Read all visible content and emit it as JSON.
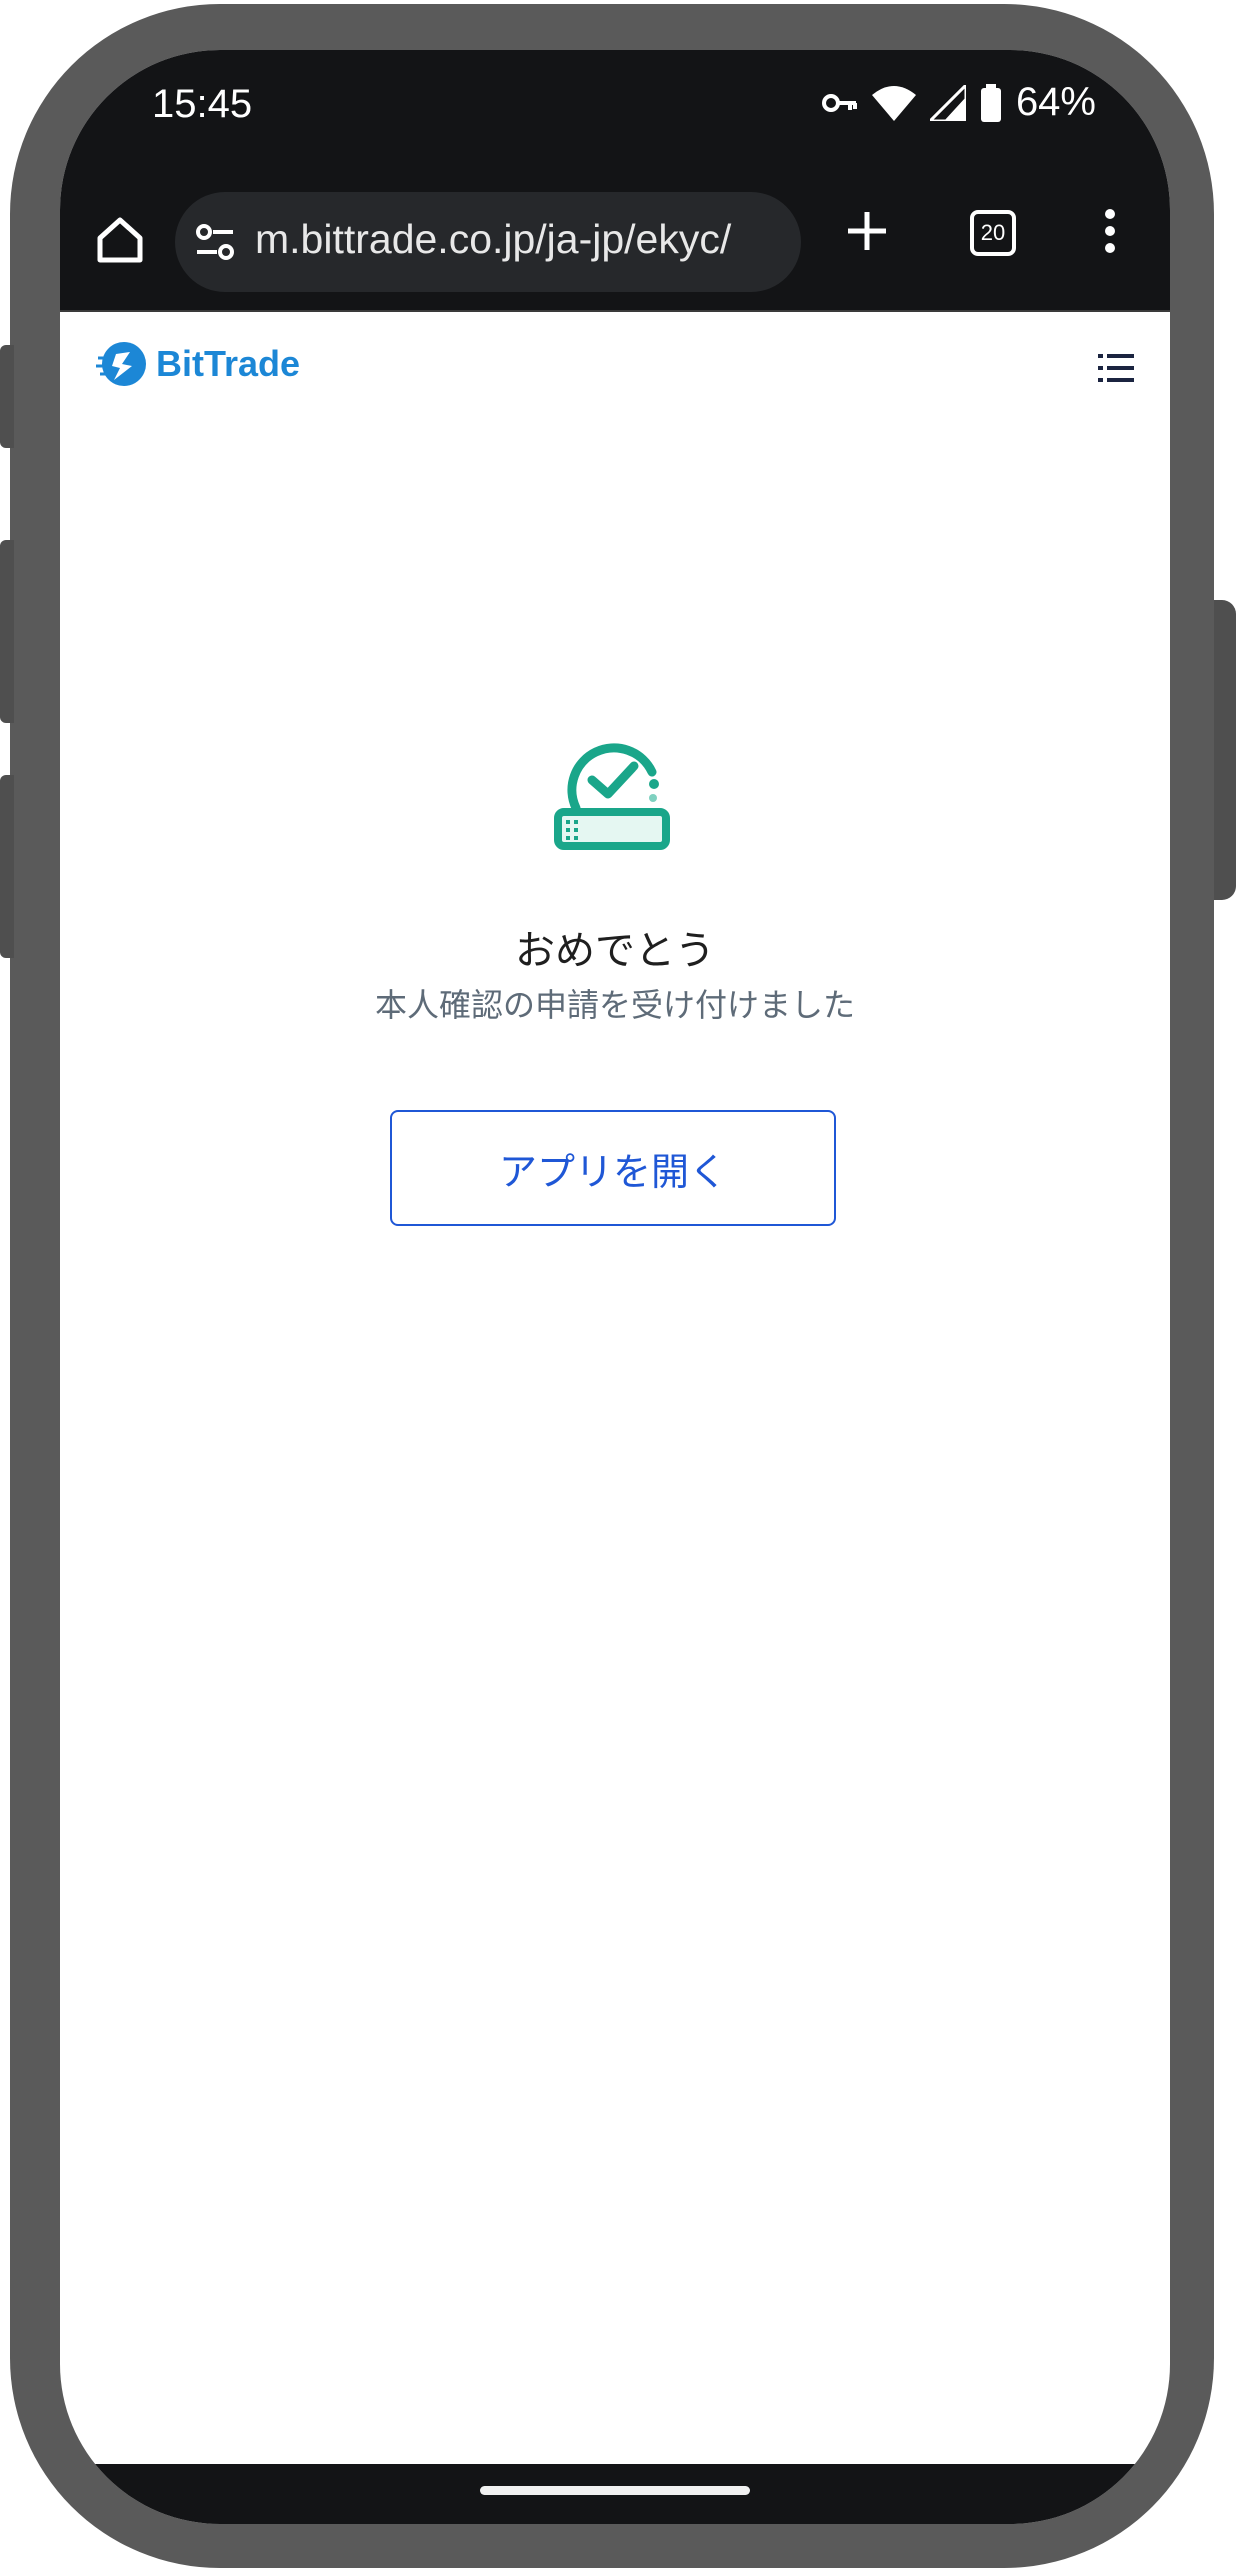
{
  "status_bar": {
    "time": "15:45",
    "battery_percent": "64%",
    "icons": [
      "vpn-key-icon",
      "wifi-icon",
      "signal-icon",
      "battery-icon"
    ]
  },
  "browser": {
    "url": "m.bittrade.co.jp/ja-jp/ekyc/",
    "tab_count": "20",
    "icons": [
      "home-icon",
      "site-settings-icon",
      "new-tab-icon",
      "tabs-icon",
      "menu-icon"
    ]
  },
  "site": {
    "logo_text": "BitTrade",
    "menu_icon": "hamburger-icon"
  },
  "result": {
    "title": "おめでとう",
    "message": "本人確認の申請を受け付けました",
    "open_app_button": "アプリを開く",
    "icon": "success-check-icon"
  },
  "colors": {
    "brand_blue": "#1c87d6",
    "success_teal": "#1aa68a",
    "button_blue": "#1f57d6",
    "chrome_dark": "#131416"
  }
}
